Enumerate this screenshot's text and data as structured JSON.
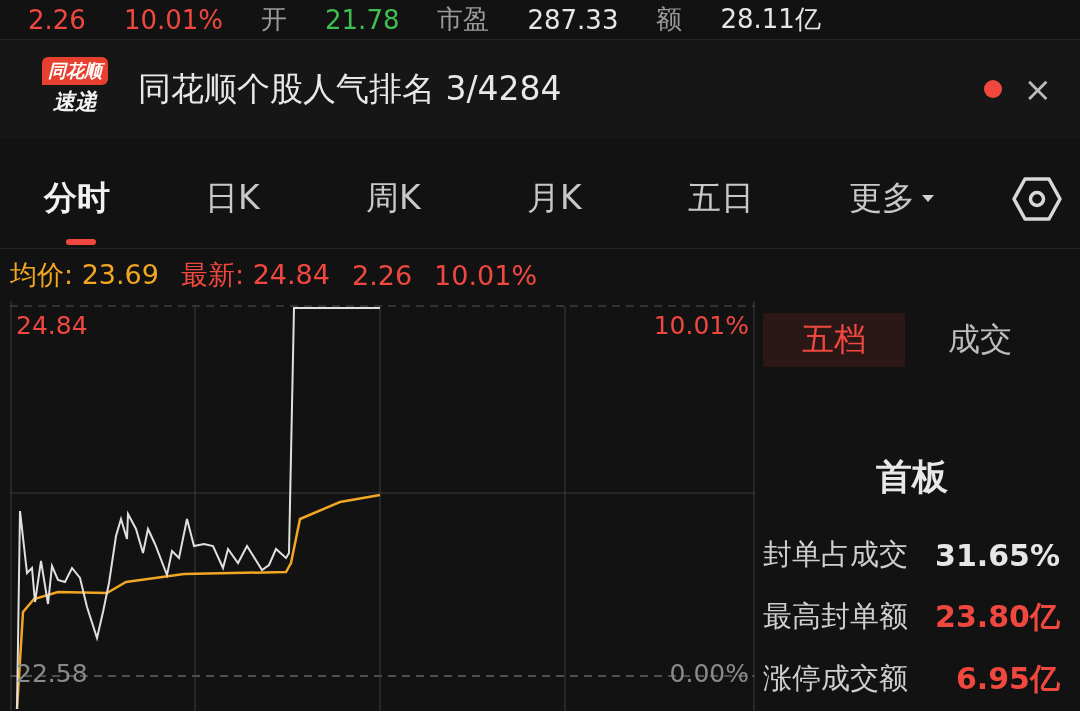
{
  "quote_row": [
    {
      "text": "2.26",
      "color": "#f0483e"
    },
    {
      "text": "10.01%",
      "color": "#f0483e"
    },
    {
      "text": "开",
      "color": "#9a9a9a"
    },
    {
      "text": "21.78",
      "color": "#3fbf4f"
    },
    {
      "text": "市盈",
      "color": "#9a9a9a"
    },
    {
      "text": "287.33",
      "color": "#e6e6e6"
    },
    {
      "text": "额",
      "color": "#9a9a9a"
    },
    {
      "text": "28.11亿",
      "color": "#e6e6e6"
    }
  ],
  "banner": {
    "logo_top": "同花顺",
    "logo_bottom": "速递",
    "title": "同花顺个股人气排名 3/4284",
    "unread": true,
    "close": "×"
  },
  "tabs": [
    {
      "label": "分时",
      "selected": true,
      "kind": "text"
    },
    {
      "label": "日K",
      "selected": false,
      "kind": "text"
    },
    {
      "label": "周K",
      "selected": false,
      "kind": "text"
    },
    {
      "label": "月K",
      "selected": false,
      "kind": "text"
    },
    {
      "label": "五日",
      "selected": false,
      "kind": "text"
    },
    {
      "label": "更多",
      "selected": false,
      "kind": "dropdown"
    }
  ],
  "summary": [
    {
      "text": "均价: 23.69",
      "color": "#f3a623"
    },
    {
      "text": "最新: 24.84",
      "color": "#f0483e"
    },
    {
      "text": "2.26",
      "color": "#f0483e"
    },
    {
      "text": "10.01%",
      "color": "#f0483e"
    }
  ],
  "chart": {
    "kind": "picture",
    "top_price": "24.84",
    "top_pct": "10.01%",
    "bottom_price": "22.58",
    "bottom_pct": "0.00%"
  },
  "panel": {
    "tabs": [
      {
        "label": "五档",
        "selected": true
      },
      {
        "label": "成交",
        "selected": false
      }
    ],
    "heading": "首板",
    "stats": [
      {
        "label": "封单占成交",
        "value": "31.65%",
        "color": "#e6e6e6"
      },
      {
        "label": "最高封单额",
        "value": "23.80亿",
        "color": "#f0483e"
      },
      {
        "label": "涨停成交额",
        "value": "6.95亿",
        "color": "#f0483e"
      }
    ]
  }
}
